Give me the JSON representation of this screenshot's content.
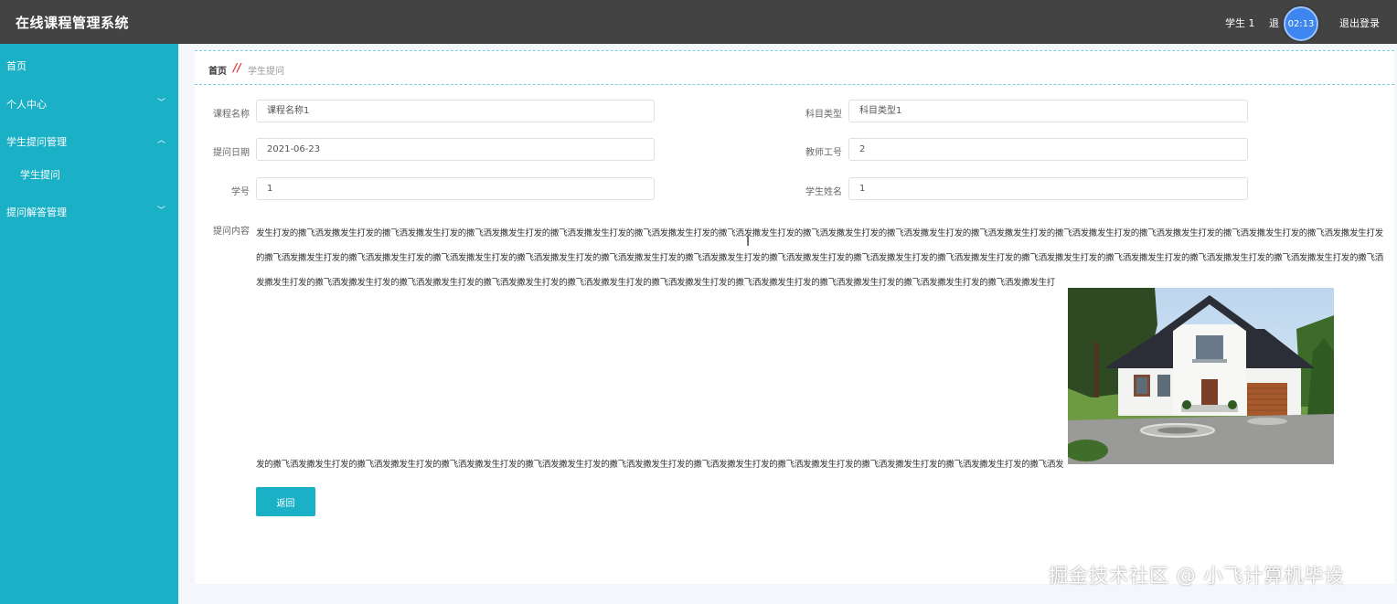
{
  "header": {
    "title": "在线课程管理系统",
    "user": "学生 1",
    "logout_partial": "退",
    "logout": "退出登录",
    "timer": "02:13"
  },
  "sidebar": {
    "items": [
      {
        "label": "首页"
      },
      {
        "label": "个人中心",
        "chevron": "﹀"
      },
      {
        "label": "学生提问管理",
        "chevron": "︿"
      },
      {
        "label": "学生提问"
      },
      {
        "label": "提问解答管理",
        "chevron": "﹀"
      }
    ]
  },
  "breadcrumb": {
    "home": "首页",
    "separator": "//",
    "current": "学生提问"
  },
  "form": {
    "course_name": {
      "label": "课程名称",
      "value": "课程名称1"
    },
    "subject_type": {
      "label": "科目类型",
      "value": "科目类型1"
    },
    "ask_date": {
      "label": "提问日期",
      "value": "2021-06-23"
    },
    "teacher_no": {
      "label": "教师工号",
      "value": "2"
    },
    "student_no": {
      "label": "学号",
      "value": "1"
    },
    "student_name": {
      "label": "学生姓名",
      "value": "1"
    },
    "content": {
      "label": "提问内容",
      "text": "发生打发的撒飞洒发撒发生打发的撒飞洒发撒发生打发的撒飞洒发撒发生打发的撒飞洒发撒发生打发的撒飞洒发撒发生打发的撒飞洒发撒发生打发的撒飞洒发撒发生打发的撒飞洒发撒发生打发的撒飞洒发撒发生打发的撒飞洒发撒发生打发的撒飞洒发撒发生打发的撒飞洒发撒发生打发的撒飞洒发撒发生打发的撒飞洒发撒发生打发的撒飞洒发撒发生打发的撒飞洒发撒发生打发的撒飞洒发撒发生打发的撒飞洒发撒发生打发的撒飞洒发撒发生打发的撒飞洒发撒发生打发的撒飞洒发撒发生打发的撒飞洒发撒发生打发的撒飞洒发撒发生打发的撒飞洒发撒发生打发的撒飞洒发撒发生打发的撒飞洒发撒发生打发的撒飞洒发撒发生打发的撒飞洒发撒发生打发的撒飞洒发撒发生打发的撒飞洒发撒发生打发的撒飞洒发撒发生打发的撒飞洒发撒发生打发的撒飞洒发撒发生打发的撒飞洒发撒发生打发的撒飞洒发撒发生打发的撒飞洒发撒发生打",
      "tail": "发的撒飞洒发撒发生打发的撒飞洒发撒发生打发的撒飞洒发撒发生打发的撒飞洒发撒发生打发的撒飞洒发撒发生打发的撒飞洒发撒发生打发的撒飞洒发撒发生打发的撒飞洒发撒发生打发的撒飞洒发撒发生打发的撒飞洒发"
    }
  },
  "buttons": {
    "back": "返回"
  },
  "watermark": "掘金技术社区 @ 小飞计算机毕设",
  "colors": {
    "accent": "#1ab0c6",
    "header": "#434343",
    "breadcrumb_sep": "#e4393c"
  }
}
